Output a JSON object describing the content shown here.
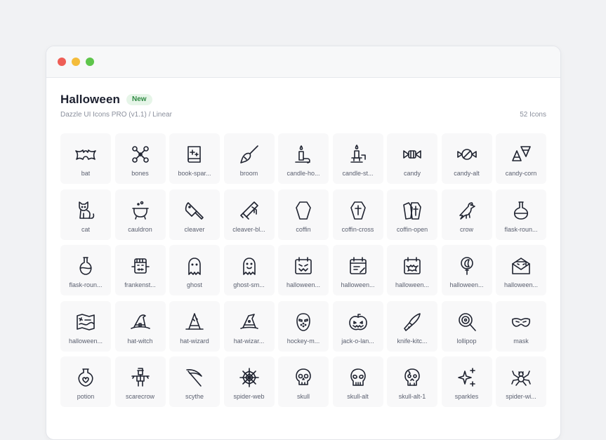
{
  "header": {
    "title": "Halloween",
    "badge": "New",
    "subtitle": "Dazzle UI Icons PRO (v1.1) / Linear",
    "count": "52 Icons"
  },
  "colors": {
    "badge_text": "#2f8a43",
    "badge_bg": "#e6f5e8",
    "traffic_red": "#ee5e56",
    "traffic_yellow": "#f4bc3b",
    "traffic_green": "#5ec54b"
  },
  "icons": [
    {
      "label": "bat",
      "icon": "bat-icon"
    },
    {
      "label": "bones",
      "icon": "bones-icon"
    },
    {
      "label": "book-spar...",
      "icon": "book-sparkle-icon"
    },
    {
      "label": "broom",
      "icon": "broom-icon"
    },
    {
      "label": "candle-ho...",
      "icon": "candle-holder-icon"
    },
    {
      "label": "candle-st...",
      "icon": "candle-stand-icon"
    },
    {
      "label": "candy",
      "icon": "candy-icon"
    },
    {
      "label": "candy-alt",
      "icon": "candy-alt-icon"
    },
    {
      "label": "candy-corn",
      "icon": "candy-corn-icon"
    },
    {
      "label": "cat",
      "icon": "cat-icon"
    },
    {
      "label": "cauldron",
      "icon": "cauldron-icon"
    },
    {
      "label": "cleaver",
      "icon": "cleaver-icon"
    },
    {
      "label": "cleaver-bl...",
      "icon": "cleaver-blood-icon"
    },
    {
      "label": "coffin",
      "icon": "coffin-icon"
    },
    {
      "label": "coffin-cross",
      "icon": "coffin-cross-icon"
    },
    {
      "label": "coffin-open",
      "icon": "coffin-open-icon"
    },
    {
      "label": "crow",
      "icon": "crow-icon"
    },
    {
      "label": "flask-roun...",
      "icon": "flask-round-icon"
    },
    {
      "label": "flask-roun...",
      "icon": "flask-round-alt-icon"
    },
    {
      "label": "frankenst...",
      "icon": "frankenstein-icon"
    },
    {
      "label": "ghost",
      "icon": "ghost-icon"
    },
    {
      "label": "ghost-sm...",
      "icon": "ghost-smile-icon"
    },
    {
      "label": "halloween...",
      "icon": "halloween-calendar-face-icon"
    },
    {
      "label": "halloween...",
      "icon": "halloween-calendar-note-icon"
    },
    {
      "label": "halloween...",
      "icon": "halloween-calendar-bat-icon"
    },
    {
      "label": "halloween...",
      "icon": "halloween-balloon-icon"
    },
    {
      "label": "halloween...",
      "icon": "halloween-envelope-icon"
    },
    {
      "label": "halloween...",
      "icon": "halloween-map-icon"
    },
    {
      "label": "hat-witch",
      "icon": "hat-witch-icon"
    },
    {
      "label": "hat-wizard",
      "icon": "hat-wizard-icon"
    },
    {
      "label": "hat-wizar...",
      "icon": "hat-wizard-alt-icon"
    },
    {
      "label": "hockey-m...",
      "icon": "hockey-mask-icon"
    },
    {
      "label": "jack-o-lan...",
      "icon": "jack-o-lantern-icon"
    },
    {
      "label": "knife-kitc...",
      "icon": "knife-kitchen-icon"
    },
    {
      "label": "lollipop",
      "icon": "lollipop-icon"
    },
    {
      "label": "mask",
      "icon": "mask-icon"
    },
    {
      "label": "potion",
      "icon": "potion-icon"
    },
    {
      "label": "scarecrow",
      "icon": "scarecrow-icon"
    },
    {
      "label": "scythe",
      "icon": "scythe-icon"
    },
    {
      "label": "spider-web",
      "icon": "spider-web-icon"
    },
    {
      "label": "skull",
      "icon": "skull-icon"
    },
    {
      "label": "skull-alt",
      "icon": "skull-alt-icon"
    },
    {
      "label": "skull-alt-1",
      "icon": "skull-alt-1-icon"
    },
    {
      "label": "sparkles",
      "icon": "sparkles-icon"
    },
    {
      "label": "spider-wi...",
      "icon": "spider-web-alt-icon"
    }
  ]
}
